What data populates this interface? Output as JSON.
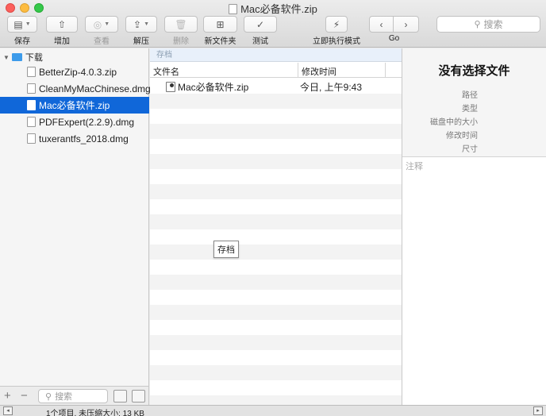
{
  "window": {
    "title": "Mac必备软件.zip"
  },
  "toolbar": {
    "save": "保存",
    "add": "增加",
    "view": "查看",
    "extract": "解压",
    "delete": "删除",
    "new_folder": "新文件夹",
    "test": "测试",
    "instant_mode": "立即执行模式",
    "go": "Go",
    "search_placeholder": "搜索"
  },
  "sidebar": {
    "root": "下载",
    "items": [
      {
        "label": "BetterZip-4.0.3.zip"
      },
      {
        "label": "CleanMyMacChinese.dmg"
      },
      {
        "label": "Mac必备软件.zip",
        "selected": true
      },
      {
        "label": "PDFExpert(2.2.9).dmg"
      },
      {
        "label": "tuxerantfs_2018.dmg"
      }
    ],
    "search_placeholder": "搜索"
  },
  "archive_bar": "存档",
  "columns": {
    "name": "文件名",
    "modified": "修改时间"
  },
  "rows": [
    {
      "name": "Mac必备软件.zip",
      "modified": "今日, 上午9:43"
    }
  ],
  "tooltip": "存档",
  "info": {
    "title": "没有选择文件",
    "labels": {
      "path": "路径",
      "kind": "类型",
      "size_on_disk": "磁盘中的大小",
      "modified": "修改时间",
      "dimensions": "尺寸"
    },
    "notes_placeholder": "注释"
  },
  "status": {
    "text": "1个项目, 未压缩大小: 13 KB"
  },
  "colors": {
    "selection": "#1067d9",
    "folder": "#3d9bea"
  }
}
